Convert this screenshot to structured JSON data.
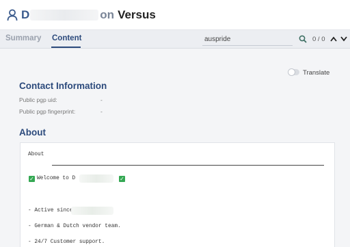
{
  "header": {
    "title_prefix": "D",
    "title_connector": "on",
    "title_name": "Versus"
  },
  "tabs": [
    {
      "label": "Summary",
      "active": false
    },
    {
      "label": "Content",
      "active": true
    }
  ],
  "search": {
    "value": "auspride",
    "count": "0 / 0"
  },
  "translate": {
    "label": "Translate",
    "enabled": false
  },
  "contact": {
    "heading": "Contact Information",
    "fields": [
      {
        "label": "Public pgp uid:",
        "value": "-"
      },
      {
        "label": "Public pgp fingerprint:",
        "value": "-"
      }
    ]
  },
  "about": {
    "heading": "About",
    "box_title": "About",
    "welcome": "Welcome to D",
    "lines": [
      "- Active since",
      "- German & Dutch vendor team.",
      "- 24/7 Customer support."
    ]
  },
  "colors": {
    "accent": "#2c4a7c",
    "check": "#34a853"
  },
  "icons": {
    "user": "user-icon",
    "search": "search-icon",
    "up": "chevron-up-icon",
    "down": "chevron-down-icon",
    "check": "checkmark-icon"
  }
}
